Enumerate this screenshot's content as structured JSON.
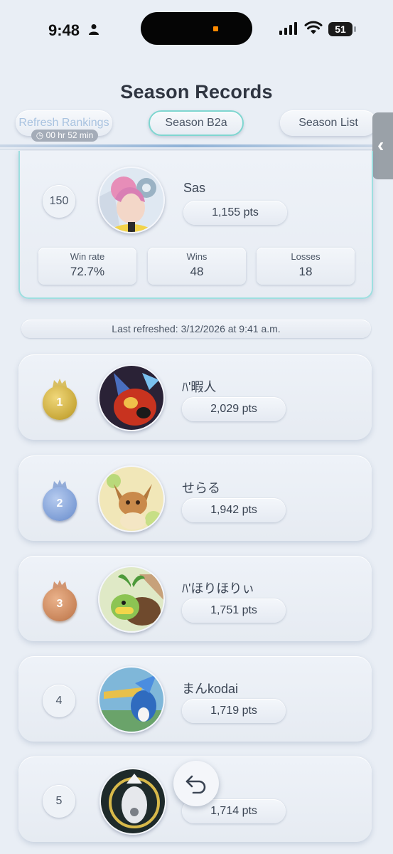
{
  "status_bar": {
    "time": "9:48",
    "battery": "51"
  },
  "page": {
    "title": "Season Records"
  },
  "tabs": {
    "refresh_label": "Refresh Rankings",
    "refresh_timer": "00 hr 52 min",
    "season_label": "Season B2a",
    "season_list_label": "Season List"
  },
  "my_record": {
    "rank": "150",
    "name": "Sas",
    "points": "1,155 pts",
    "stats": [
      {
        "label": "Win rate",
        "value": "72.7%"
      },
      {
        "label": "Wins",
        "value": "48"
      },
      {
        "label": "Losses",
        "value": "18"
      }
    ]
  },
  "last_refreshed": "Last refreshed: 3/12/2026 at 9:41 a.m.",
  "rankings": [
    {
      "rank": "1",
      "name": "ﾊ'暇人",
      "points": "2,029 pts",
      "medal": "gold"
    },
    {
      "rank": "2",
      "name": "せらる",
      "points": "1,942 pts",
      "medal": "silver"
    },
    {
      "rank": "3",
      "name": "ﾊ'ほりほりぃ",
      "points": "1,751 pts",
      "medal": "bronze"
    },
    {
      "rank": "4",
      "name": "まんkodai",
      "points": "1,719 pts",
      "medal": "none"
    },
    {
      "rank": "5",
      "name": "",
      "points": "1,714 pts",
      "medal": "none"
    }
  ],
  "colors": {
    "accent_teal": "#7fd6d0",
    "gold": "#c9a93a",
    "silver": "#7e9ed6",
    "bronze": "#c9855a"
  }
}
